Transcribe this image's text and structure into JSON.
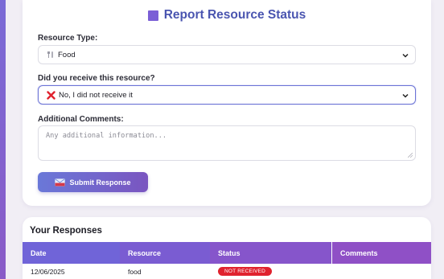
{
  "form": {
    "title": "Report Resource Status",
    "resource_type_label": "Resource Type:",
    "resource_type_value": "Food",
    "resource_type_icon": "food-icon",
    "received_label": "Did you receive this resource?",
    "received_value": "No, I did not receive it",
    "received_icon": "red-x-icon",
    "comments_label": "Additional Comments:",
    "comments_placeholder": "Any additional information...",
    "submit_label": "Submit Response",
    "submit_icon": "envelope-icon"
  },
  "responses": {
    "title": "Your Responses",
    "columns": [
      "Date",
      "Resource",
      "Status",
      "Comments"
    ],
    "rows": [
      {
        "date": "12/06/2025",
        "resource": "food",
        "status": "NOT RECEIVED",
        "comments": ""
      }
    ]
  },
  "colors": {
    "accent": "#7b5fd6",
    "title_text": "#4a55b0",
    "status_not_received": "#e0222e",
    "header_gradient_start": "#7064d8",
    "header_gradient_end": "#8f50c6"
  }
}
